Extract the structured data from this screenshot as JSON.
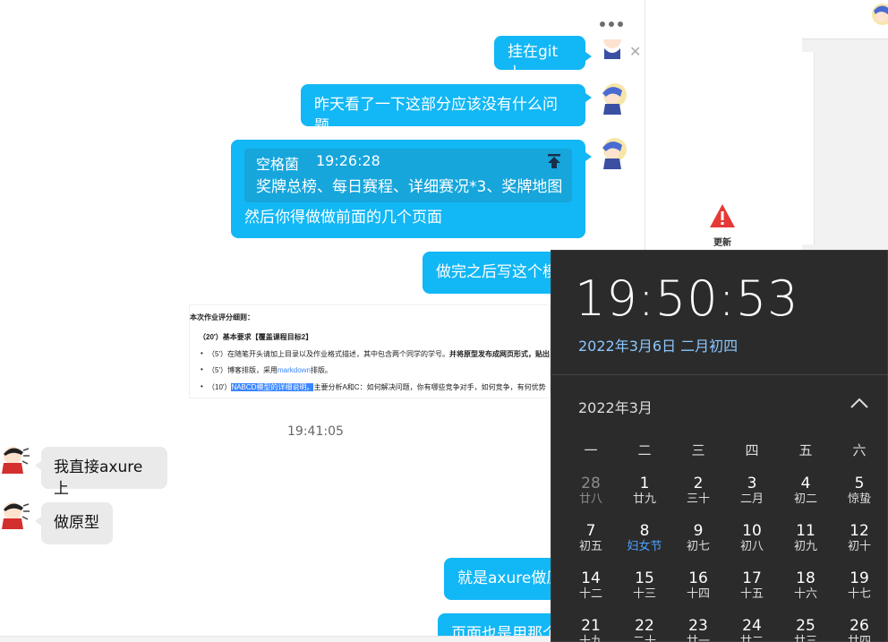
{
  "chat": {
    "messages": [
      {
        "id": "m1",
        "text": "挂在git上"
      },
      {
        "id": "m2",
        "text": "昨天看了一下这部分应该没有什么问题"
      },
      {
        "id": "m3",
        "quote_author": "空格菌",
        "quote_time": "19:26:28",
        "quote_text": "奖牌总榜、每日赛程、详细赛况*3、奖牌地图",
        "text": "然后你得做做前面的几个页面"
      },
      {
        "id": "m4",
        "text": "做完之后写这个模"
      },
      {
        "id": "m5",
        "text": "我直接axure上"
      },
      {
        "id": "m6",
        "text": "做原型"
      },
      {
        "id": "m7",
        "text": "就是axure做原"
      },
      {
        "id": "m8",
        "text": "页面也是用那个"
      }
    ],
    "timestamp": "19:41:05",
    "doc_image": {
      "title": "本次作业评分细则：",
      "section": "（20'）基本要求【覆盖课程目标2】",
      "items": [
        {
          "prefix": "（5'）在随笔开头请加上目录以及作业格式描述，其中包含两个同学的学号。",
          "bold": "并将原型发布成网页形式，贴出"
        },
        {
          "prefix": "（5'）博客排版，采用",
          "link": "markdown",
          "suffix": "排版。"
        },
        {
          "prefix": "（10'）",
          "highlight": "NABCD模型的详细说明。",
          "suffix": "主要分析A和C：如何解决问题，你有哪些竞争对手，如何竞争，有何优势"
        }
      ]
    }
  },
  "side": {
    "warning_label": "更新"
  },
  "clock": {
    "time": "19:50:53",
    "date": "2022年3月6日 二月初四",
    "month": "2022年3月",
    "weekdays": [
      "一",
      "二",
      "三",
      "四",
      "五",
      "六"
    ],
    "days": [
      [
        {
          "n": "28",
          "l": "廿八",
          "muted": true
        },
        {
          "n": "1",
          "l": "廿九"
        },
        {
          "n": "2",
          "l": "三十"
        },
        {
          "n": "3",
          "l": "二月"
        },
        {
          "n": "4",
          "l": "初二"
        },
        {
          "n": "5",
          "l": "惊蛰"
        }
      ],
      [
        {
          "n": "7",
          "l": "初五"
        },
        {
          "n": "8",
          "l": "妇女节",
          "hi": true
        },
        {
          "n": "9",
          "l": "初七"
        },
        {
          "n": "10",
          "l": "初八"
        },
        {
          "n": "11",
          "l": "初九"
        },
        {
          "n": "12",
          "l": "初十"
        }
      ],
      [
        {
          "n": "14",
          "l": "十二"
        },
        {
          "n": "15",
          "l": "十三"
        },
        {
          "n": "16",
          "l": "十四"
        },
        {
          "n": "17",
          "l": "十五"
        },
        {
          "n": "18",
          "l": "十六"
        },
        {
          "n": "19",
          "l": "十七"
        }
      ],
      [
        {
          "n": "21",
          "l": "十九"
        },
        {
          "n": "22",
          "l": "二十"
        },
        {
          "n": "23",
          "l": "廿一"
        },
        {
          "n": "24",
          "l": "廿二"
        },
        {
          "n": "25",
          "l": "廿三"
        },
        {
          "n": "26",
          "l": "廿四"
        }
      ]
    ]
  },
  "colors": {
    "bubble_mine": "#12b7f5",
    "bubble_theirs": "#eaeaea",
    "clock_bg": "#2b2b2b",
    "clock_date": "#8bc7ff"
  },
  "icons": [
    "voice-call-icon",
    "video-call-icon",
    "more-icon",
    "warning-icon",
    "pin-top-icon",
    "chevron-up-icon"
  ]
}
